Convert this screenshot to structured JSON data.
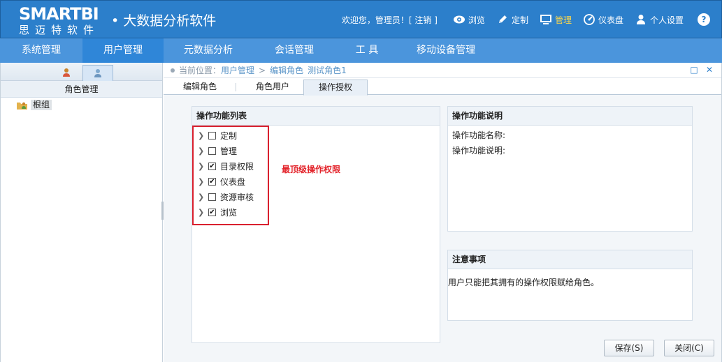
{
  "header": {
    "brand": "SMARTBI",
    "brand_sub": "思迈特软件",
    "app_title": "• 大数据分析软件",
    "welcome": "欢迎您，管理员！[ 注销 ]",
    "links": [
      {
        "label": "浏览",
        "icon": "eye-icon"
      },
      {
        "label": "定制",
        "icon": "pencil-icon"
      },
      {
        "label": "管理",
        "icon": "monitor-icon",
        "active": true
      },
      {
        "label": "仪表盘",
        "icon": "gauge-icon"
      },
      {
        "label": "个人设置",
        "icon": "user-icon"
      }
    ],
    "help": "?"
  },
  "nav": {
    "items": [
      "系统管理",
      "用户管理",
      "元数据分析",
      "会话管理",
      "工 具",
      "移动设备管理"
    ],
    "active_index": 1
  },
  "left": {
    "header": "角色管理",
    "tree_root": "根组"
  },
  "breadcrumb": {
    "label": "当前位置：",
    "items": [
      "用户管理",
      "编辑角色",
      "测试角色1"
    ]
  },
  "tabs": [
    "编辑角色",
    "角色用户",
    "操作授权"
  ],
  "active_tab": 2,
  "func_panel": {
    "title": "操作功能列表",
    "items": [
      {
        "label": "定制",
        "checked": false
      },
      {
        "label": "管理",
        "checked": false
      },
      {
        "label": "目录权限",
        "checked": true
      },
      {
        "label": "仪表盘",
        "checked": true
      },
      {
        "label": "资源审核",
        "checked": false
      },
      {
        "label": "浏览",
        "checked": true
      }
    ],
    "annotation": "最顶级操作权限"
  },
  "desc_panel": {
    "title": "操作功能说明",
    "name_label": "操作功能名称:",
    "desc_label": "操作功能说明:"
  },
  "notes_panel": {
    "title": "注意事项",
    "text": "用户只能把其拥有的操作权限赋给角色。"
  },
  "buttons": {
    "save": "保存(S)",
    "close": "关闭(C)"
  },
  "colors": {
    "header_bg": "#2c7fcb",
    "nav_bg": "#4b95dc",
    "nav_active": "#2f86d8",
    "annotation_red": "#e3242b",
    "active_link": "#ffd84a"
  }
}
